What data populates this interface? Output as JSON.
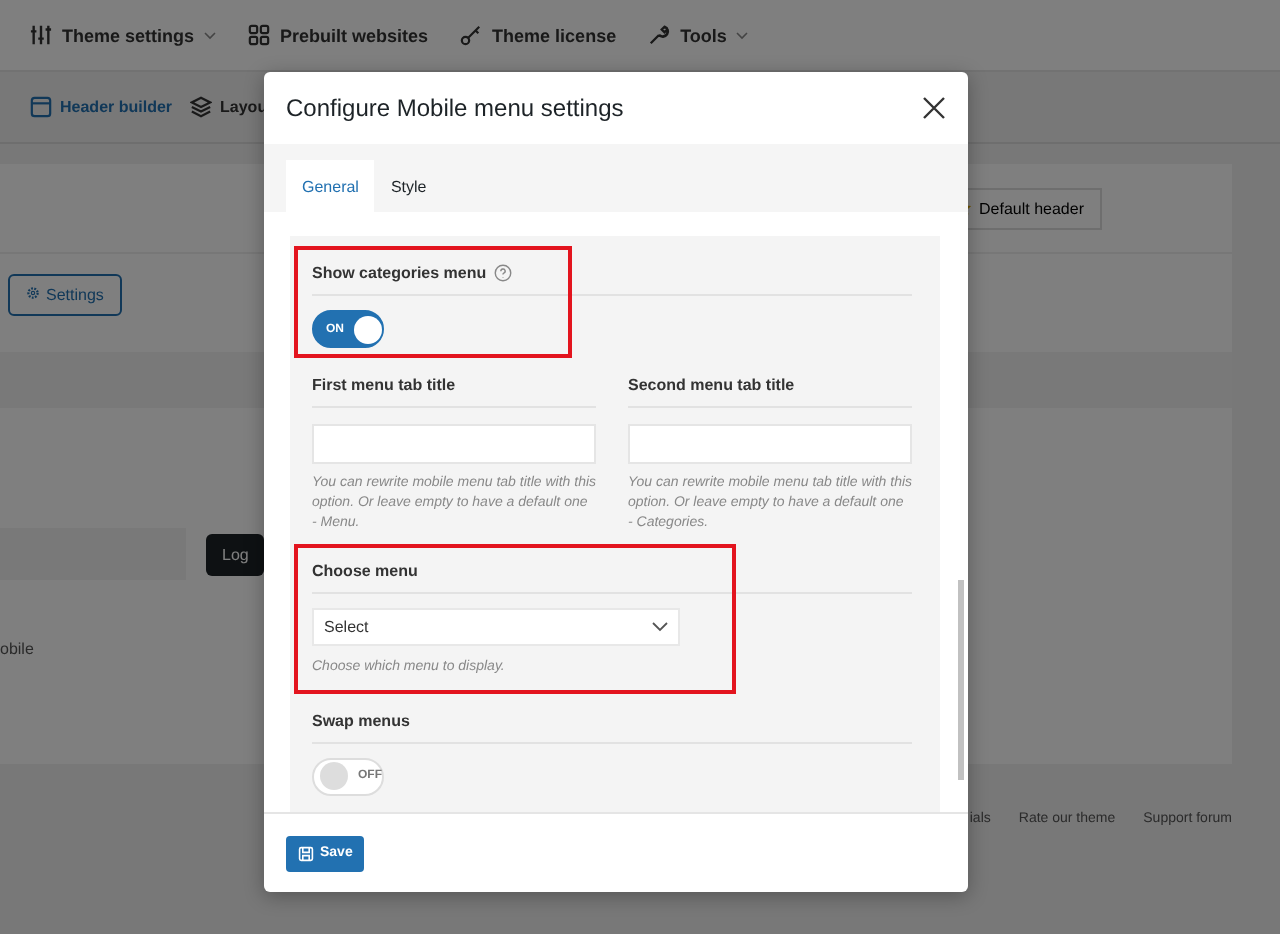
{
  "top_nav": [
    {
      "label": "Theme settings",
      "dropdown": true
    },
    {
      "label": "Prebuilt websites",
      "dropdown": false
    },
    {
      "label": "Theme license",
      "dropdown": false
    },
    {
      "label": "Tools",
      "dropdown": true
    }
  ],
  "sub_nav": [
    {
      "label": "Header builder",
      "selected": true
    },
    {
      "label": "Layou",
      "selected": false
    }
  ],
  "background": {
    "default_header_button": "Default header",
    "settings_button": "Settings",
    "dark_button": "Log",
    "side_text": "obile",
    "footer_links": [
      "ials",
      "Rate our theme",
      "Support forum"
    ]
  },
  "modal": {
    "title": "Configure Mobile menu settings",
    "tabs": [
      {
        "label": "General",
        "selected": true
      },
      {
        "label": "Style",
        "selected": false
      }
    ],
    "settings": [
      {
        "kind": "toggle",
        "label": "Show categories menu",
        "help": true,
        "highlighted": true,
        "toggle": {
          "on": true,
          "label": "ON"
        }
      },
      {
        "kind": "text_pair",
        "highlighted": false,
        "fields": [
          {
            "label": "First menu tab title",
            "description": "You can rewrite mobile menu tab title with this option. Or leave empty to have a default one - Menu."
          },
          {
            "label": "Second menu tab title",
            "description": "You can rewrite mobile menu tab title with this option. Or leave empty to have a default one - Categories."
          }
        ]
      },
      {
        "kind": "select",
        "label": "Choose menu",
        "highlighted": true,
        "value": "Select",
        "description": "Choose which menu to display."
      },
      {
        "kind": "toggle",
        "label": "Swap menus",
        "help": false,
        "highlighted": false,
        "toggle": {
          "on": false,
          "label": "OFF"
        }
      }
    ],
    "save_button": "Save"
  }
}
